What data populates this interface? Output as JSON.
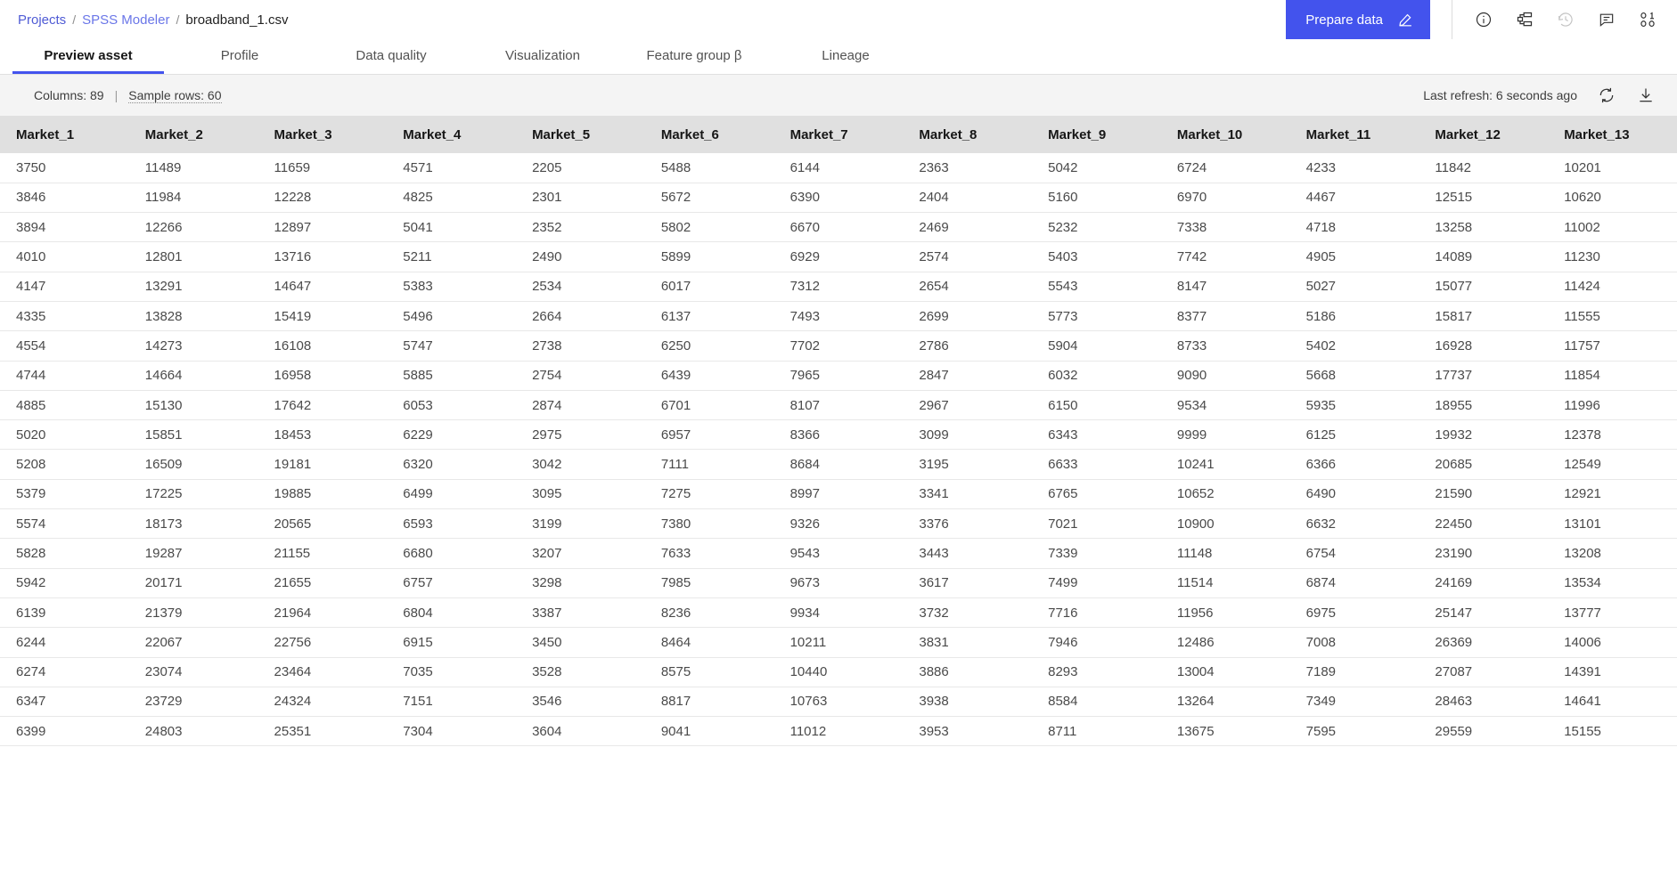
{
  "breadcrumb": {
    "projects": "Projects",
    "separator": "/",
    "app": "SPSS Modeler",
    "file": "broadband_1.csv"
  },
  "header": {
    "prepare_data_label": "Prepare data",
    "accent_color": "#4353ed",
    "icons": [
      {
        "name": "info-icon",
        "disabled": false
      },
      {
        "name": "data-structure-icon",
        "disabled": false
      },
      {
        "name": "history-icon",
        "disabled": true
      },
      {
        "name": "comment-icon",
        "disabled": false
      },
      {
        "name": "binary-data-icon",
        "disabled": false
      }
    ]
  },
  "tabs": [
    {
      "label": "Preview asset",
      "active": true
    },
    {
      "label": "Profile",
      "active": false
    },
    {
      "label": "Data quality",
      "active": false
    },
    {
      "label": "Visualization",
      "active": false
    },
    {
      "label": "Feature group β",
      "active": false
    },
    {
      "label": "Lineage",
      "active": false
    }
  ],
  "infobar": {
    "columns_label": "Columns: 89",
    "pipe": "|",
    "sample_rows_label": "Sample rows: 60",
    "last_refresh": "Last refresh: 6 seconds ago",
    "refresh_icon": "refresh-icon",
    "download_icon": "download-icon"
  },
  "table": {
    "columns": [
      "Market_1",
      "Market_2",
      "Market_3",
      "Market_4",
      "Market_5",
      "Market_6",
      "Market_7",
      "Market_8",
      "Market_9",
      "Market_10",
      "Market_11",
      "Market_12",
      "Market_13"
    ],
    "rows": [
      [
        "3750",
        "11489",
        "11659",
        "4571",
        "2205",
        "5488",
        "6144",
        "2363",
        "5042",
        "6724",
        "4233",
        "11842",
        "10201"
      ],
      [
        "3846",
        "11984",
        "12228",
        "4825",
        "2301",
        "5672",
        "6390",
        "2404",
        "5160",
        "6970",
        "4467",
        "12515",
        "10620"
      ],
      [
        "3894",
        "12266",
        "12897",
        "5041",
        "2352",
        "5802",
        "6670",
        "2469",
        "5232",
        "7338",
        "4718",
        "13258",
        "11002"
      ],
      [
        "4010",
        "12801",
        "13716",
        "5211",
        "2490",
        "5899",
        "6929",
        "2574",
        "5403",
        "7742",
        "4905",
        "14089",
        "11230"
      ],
      [
        "4147",
        "13291",
        "14647",
        "5383",
        "2534",
        "6017",
        "7312",
        "2654",
        "5543",
        "8147",
        "5027",
        "15077",
        "11424"
      ],
      [
        "4335",
        "13828",
        "15419",
        "5496",
        "2664",
        "6137",
        "7493",
        "2699",
        "5773",
        "8377",
        "5186",
        "15817",
        "11555"
      ],
      [
        "4554",
        "14273",
        "16108",
        "5747",
        "2738",
        "6250",
        "7702",
        "2786",
        "5904",
        "8733",
        "5402",
        "16928",
        "11757"
      ],
      [
        "4744",
        "14664",
        "16958",
        "5885",
        "2754",
        "6439",
        "7965",
        "2847",
        "6032",
        "9090",
        "5668",
        "17737",
        "11854"
      ],
      [
        "4885",
        "15130",
        "17642",
        "6053",
        "2874",
        "6701",
        "8107",
        "2967",
        "6150",
        "9534",
        "5935",
        "18955",
        "11996"
      ],
      [
        "5020",
        "15851",
        "18453",
        "6229",
        "2975",
        "6957",
        "8366",
        "3099",
        "6343",
        "9999",
        "6125",
        "19932",
        "12378"
      ],
      [
        "5208",
        "16509",
        "19181",
        "6320",
        "3042",
        "7111",
        "8684",
        "3195",
        "6633",
        "10241",
        "6366",
        "20685",
        "12549"
      ],
      [
        "5379",
        "17225",
        "19885",
        "6499",
        "3095",
        "7275",
        "8997",
        "3341",
        "6765",
        "10652",
        "6490",
        "21590",
        "12921"
      ],
      [
        "5574",
        "18173",
        "20565",
        "6593",
        "3199",
        "7380",
        "9326",
        "3376",
        "7021",
        "10900",
        "6632",
        "22450",
        "13101"
      ],
      [
        "5828",
        "19287",
        "21155",
        "6680",
        "3207",
        "7633",
        "9543",
        "3443",
        "7339",
        "11148",
        "6754",
        "23190",
        "13208"
      ],
      [
        "5942",
        "20171",
        "21655",
        "6757",
        "3298",
        "7985",
        "9673",
        "3617",
        "7499",
        "11514",
        "6874",
        "24169",
        "13534"
      ],
      [
        "6139",
        "21379",
        "21964",
        "6804",
        "3387",
        "8236",
        "9934",
        "3732",
        "7716",
        "11956",
        "6975",
        "25147",
        "13777"
      ],
      [
        "6244",
        "22067",
        "22756",
        "6915",
        "3450",
        "8464",
        "10211",
        "3831",
        "7946",
        "12486",
        "7008",
        "26369",
        "14006"
      ],
      [
        "6274",
        "23074",
        "23464",
        "7035",
        "3528",
        "8575",
        "10440",
        "3886",
        "8293",
        "13004",
        "7189",
        "27087",
        "14391"
      ],
      [
        "6347",
        "23729",
        "24324",
        "7151",
        "3546",
        "8817",
        "10763",
        "3938",
        "8584",
        "13264",
        "7349",
        "28463",
        "14641"
      ],
      [
        "6399",
        "24803",
        "25351",
        "7304",
        "3604",
        "9041",
        "11012",
        "3953",
        "8711",
        "13675",
        "7595",
        "29559",
        "15155"
      ]
    ]
  }
}
